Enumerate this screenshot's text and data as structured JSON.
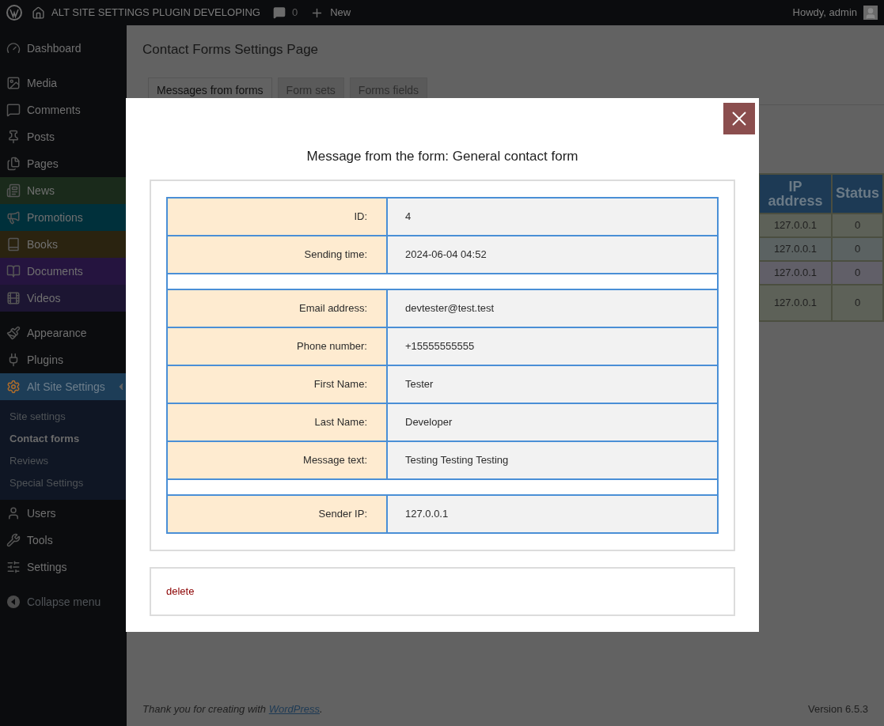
{
  "admin_bar": {
    "site_name": "ALT SITE SETTINGS PLUGIN DEVELOPING",
    "comments_count": "0",
    "new_label": "New",
    "greeting": "Howdy, admin"
  },
  "sidebar": {
    "sections": [
      [
        {
          "label": "Dashboard",
          "selected": false
        }
      ],
      [
        {
          "label": "Media",
          "selected": false
        },
        {
          "label": "Comments",
          "selected": false
        },
        {
          "label": "Posts",
          "selected": false
        },
        {
          "label": "Pages",
          "selected": false
        },
        {
          "label": "News",
          "selected": false,
          "color": "#1a2a1b"
        },
        {
          "label": "Promotions",
          "selected": false,
          "color": "#00303b"
        },
        {
          "label": "Books",
          "selected": false,
          "color": "#2a2310"
        },
        {
          "label": "Documents",
          "selected": false,
          "color": "#25143f"
        },
        {
          "label": "Videos",
          "selected": false,
          "color": "#1c1532"
        }
      ],
      [
        {
          "label": "Appearance",
          "selected": false
        },
        {
          "label": "Plugins",
          "selected": false
        },
        {
          "label": "Alt Site Settings",
          "selected": true,
          "children": [
            {
              "label": "Site settings",
              "selected": false
            },
            {
              "label": "Contact forms",
              "selected": true
            },
            {
              "label": "Reviews",
              "selected": false
            },
            {
              "label": "Special Settings",
              "selected": false
            }
          ]
        },
        {
          "label": "Users",
          "selected": false
        },
        {
          "label": "Tools",
          "selected": false
        },
        {
          "label": "Settings",
          "selected": false
        }
      ]
    ],
    "collapse_label": "Collapse menu"
  },
  "page": {
    "title": "Contact Forms Settings Page",
    "tabs": [
      {
        "label": "Messages from forms",
        "selected": true
      },
      {
        "label": "Form sets",
        "selected": false
      },
      {
        "label": "Forms fields",
        "selected": false
      }
    ],
    "table": {
      "columns": [
        "IP address",
        "Status"
      ],
      "rows": [
        {
          "cells": [
            "127.0.0.1",
            "0"
          ],
          "color": "#5d6158"
        },
        {
          "cells": [
            "127.0.0.1",
            "0"
          ],
          "color": "#5b6262"
        },
        {
          "cells": [
            "127.0.0.1",
            "0"
          ],
          "color": "#615f68"
        },
        {
          "cells": [
            "127.0.0.1",
            "0"
          ],
          "color": "#5d6158"
        }
      ]
    }
  },
  "modal": {
    "title": "Message from the form: General contact form",
    "rows": [
      {
        "kind": "field",
        "label": "ID:",
        "value": "4"
      },
      {
        "kind": "field",
        "label": "Sending time:",
        "value": "2024-06-04 04:52"
      },
      {
        "kind": "spacer"
      },
      {
        "kind": "field",
        "label": "Email address:",
        "value": "devtester@test.test"
      },
      {
        "kind": "field",
        "label": "Phone number:",
        "value": "+15555555555"
      },
      {
        "kind": "field",
        "label": "First Name:",
        "value": "Tester"
      },
      {
        "kind": "field",
        "label": "Last Name:",
        "value": "Developer"
      },
      {
        "kind": "field",
        "label": "Message text:",
        "value": "Testing Testing Testing"
      },
      {
        "kind": "spacer"
      },
      {
        "kind": "field",
        "label": "Sender IP:",
        "value": "127.0.0.1"
      }
    ],
    "delete_label": "delete"
  },
  "footer": {
    "thanks": "Thank you for creating with",
    "link": "WordPress",
    "after_link": ".",
    "version": "Version 6.5.3"
  }
}
